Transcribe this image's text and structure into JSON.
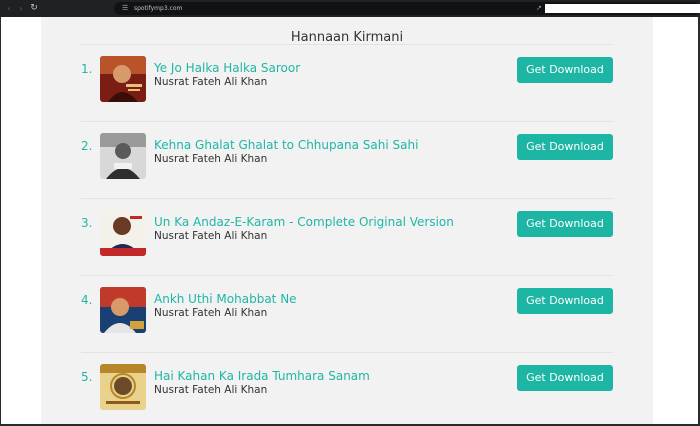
{
  "browser": {
    "url": "spotifymp3.com",
    "icons": {
      "back": "arrow-left-icon",
      "forward": "arrow-right-icon",
      "reload": "reload-icon",
      "site_info": "site-info-icon",
      "share": "share-icon"
    }
  },
  "page": {
    "artist_heading": "Hannaan Kirmani",
    "download_label": "Get Download",
    "accent_color": "#1db5a3"
  },
  "tracks": [
    {
      "number": "1.",
      "title": "Ye Jo Halka Halka Saroor",
      "artist": "Nusrat Fateh Ali Khan"
    },
    {
      "number": "2.",
      "title": "Kehna Ghalat Ghalat to Chhupana Sahi Sahi",
      "artist": "Nusrat Fateh Ali Khan"
    },
    {
      "number": "3.",
      "title": "Un Ka Andaz-E-Karam - Complete Original Version",
      "artist": "Nusrat Fateh Ali Khan"
    },
    {
      "number": "4.",
      "title": "Ankh Uthi Mohabbat Ne",
      "artist": "Nusrat Fateh Ali Khan"
    },
    {
      "number": "5.",
      "title": "Hai Kahan Ka Irada Tumhara Sanam",
      "artist": "Nusrat Fateh Ali Khan"
    }
  ]
}
